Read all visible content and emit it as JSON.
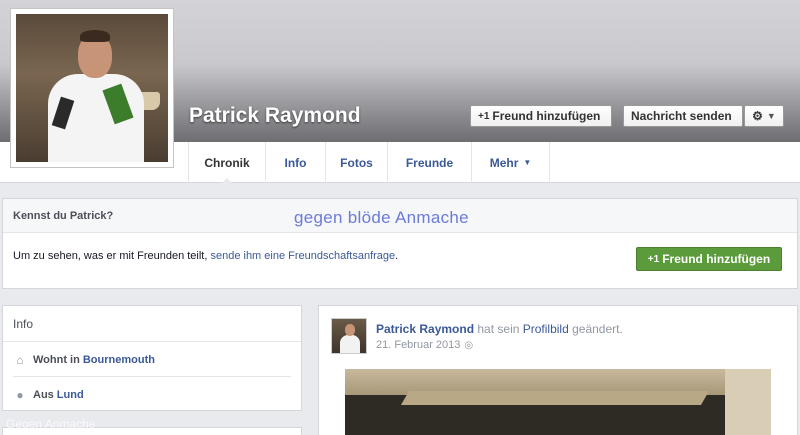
{
  "profile": {
    "name": "Patrick Raymond",
    "add_friend_label": "Freund hinzufügen",
    "add_friend_icon": "+1",
    "message_label": "Nachricht senden",
    "gear_icon": "⚙",
    "caret_icon": "▼"
  },
  "nav": {
    "tabs": [
      {
        "label": "Chronik"
      },
      {
        "label": "Info"
      },
      {
        "label": "Fotos"
      },
      {
        "label": "Freunde"
      },
      {
        "label": "Mehr"
      }
    ],
    "more_caret": "▼"
  },
  "know_box": {
    "title": "Kennst du Patrick?",
    "text_prefix": "Um zu sehen, was er mit Freunden teilt, ",
    "link_text": "sende ihm eine Freundschaftsanfrage",
    "text_suffix": ".",
    "button_label": "Freund hinzufügen",
    "button_icon": "+1"
  },
  "watermarks": {
    "main": "gegen blöde Anmache",
    "small": "Gegen Anmache"
  },
  "info": {
    "title": "Info",
    "rows": [
      {
        "icon": "home-icon",
        "prefix": "Wohnt in",
        "value": "Bournemouth"
      },
      {
        "icon": "location-pin-icon",
        "prefix": "Aus",
        "value": "Lund"
      }
    ]
  },
  "post": {
    "author": "Patrick Raymond",
    "action_prefix": " hat sein ",
    "action_link": "Profilbild",
    "action_suffix": " geändert.",
    "date": "21. Februar 2013",
    "privacy_icon": "globe-icon"
  },
  "colors": {
    "link": "#3b5998",
    "green_button": "#5b9b3c",
    "watermark": "#6c7bd8",
    "background": "#e9eaed"
  }
}
